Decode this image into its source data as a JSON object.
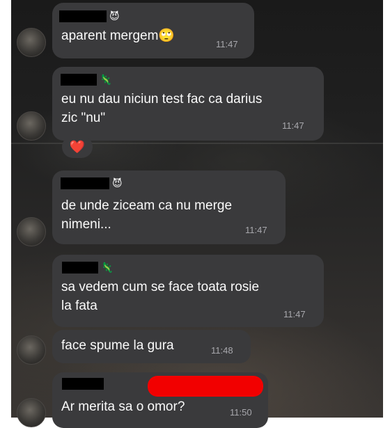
{
  "messages": [
    {
      "sender_emoji": "😈",
      "text": "aparent mergem🙄",
      "time": "11:47"
    },
    {
      "sender_emoji": "🦎",
      "text": "eu nu dau niciun test fac ca darius\nzic \"nu\"",
      "time": "11:47",
      "reaction": "❤️"
    },
    {
      "sender_emoji": "😈",
      "text": "de unde ziceam ca nu merge\nnimeni...",
      "time": "11:47"
    },
    {
      "sender_emoji": "🦎",
      "text": "sa vedem cum se face toata rosie\nla fata",
      "time": "11:47"
    },
    {
      "text": "face spume la gura",
      "time": "11:48"
    },
    {
      "sender_emoji": "",
      "text": "Ar merita sa o omor?",
      "time": "11:50"
    }
  ],
  "colors": {
    "bubble": "#3a3a3c",
    "text": "#fafafa",
    "time": "#a8a8ad",
    "redaction_red": "#f20000"
  }
}
